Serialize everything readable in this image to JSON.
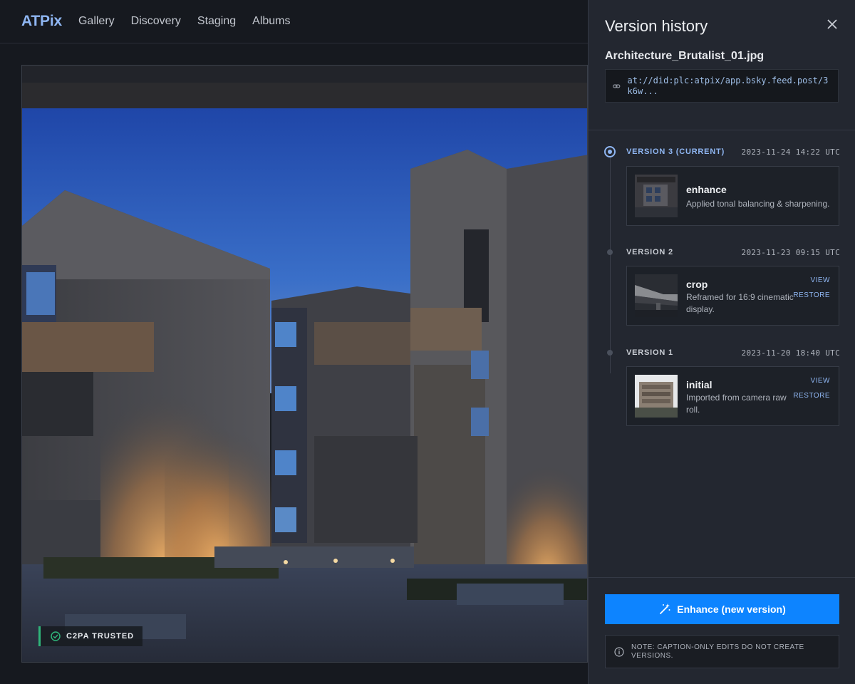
{
  "nav": {
    "brand": "ATPix",
    "links": [
      "Gallery",
      "Discovery",
      "Staging",
      "Albums"
    ]
  },
  "viewer": {
    "badge": "C2PA TRUSTED"
  },
  "panel": {
    "title": "Version history",
    "filename": "Architecture_Brutalist_01.jpg",
    "uri": "at://did:plc:atpix/app.bsky.feed.post/3k6w...",
    "versions": [
      {
        "label": "VERSION 3 (CURRENT)",
        "time": "2023-11-24 14:22 UTC",
        "title": "enhance",
        "desc": "Applied tonal balancing & sharpening.",
        "current": true
      },
      {
        "label": "VERSION 2",
        "time": "2023-11-23 09:15 UTC",
        "title": "crop",
        "desc": "Reframed for 16:9 cinematic display.",
        "view": "VIEW",
        "restore": "RESTORE"
      },
      {
        "label": "VERSION 1",
        "time": "2023-11-20 18:40 UTC",
        "title": "initial",
        "desc": "Imported from camera raw roll.",
        "view": "VIEW",
        "restore": "RESTORE"
      }
    ],
    "enhance_button": "Enhance (new version)",
    "note": "NOTE: CAPTION-ONLY EDITS DO NOT CREATE VERSIONS."
  },
  "colors": {
    "accent": "#0d84ff",
    "brand": "#8fb6f2",
    "trusted": "#2fb57a"
  }
}
